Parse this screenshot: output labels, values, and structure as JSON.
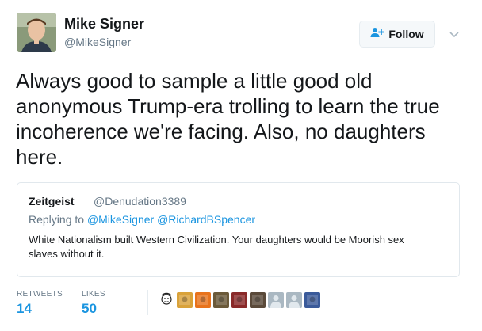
{
  "author": {
    "name": "Mike Signer",
    "handle": "@MikeSigner"
  },
  "follow": {
    "label": "Follow",
    "icon": "person-add-icon",
    "accent": "#1b95e0"
  },
  "menu": {
    "icon": "chevron-down-icon"
  },
  "tweet": {
    "lines": [
      "Always good to sample a little good old",
      "anonymous Trump-era trolling to learn the true",
      "incoherence we're facing. Also, no daughters",
      "here."
    ]
  },
  "quote": {
    "name": "Zeitgeist",
    "handle": "@Denudation3389",
    "reply_prefix": "Replying to",
    "reply_to": [
      "@MikeSigner",
      "@RichardBSpencer"
    ],
    "text_lines": [
      "White Nationalism built Western Civilization. Your daughters would be Moorish sex",
      "slaves without it."
    ]
  },
  "stats": {
    "retweets_label": "RETWEETS",
    "retweets_value": "14",
    "likes_label": "LIKES",
    "likes_value": "50"
  },
  "liked_by": [
    {
      "name": "cartoon-face-avatar",
      "color": "#ffffff"
    },
    {
      "name": "pixel-art-avatar",
      "color": "#d9a23a"
    },
    {
      "name": "orange-bird-avatar",
      "color": "#e8731c"
    },
    {
      "name": "building-avatar",
      "color": "#6b5a3a"
    },
    {
      "name": "comic-avatar",
      "color": "#8a2a2a"
    },
    {
      "name": "crowd-avatar",
      "color": "#5a4a3a"
    },
    {
      "name": "default-egg-avatar",
      "color": "#aab8c2"
    },
    {
      "name": "default-egg-avatar",
      "color": "#aab8c2"
    },
    {
      "name": "blue-character-avatar",
      "color": "#3a5a9a"
    }
  ]
}
